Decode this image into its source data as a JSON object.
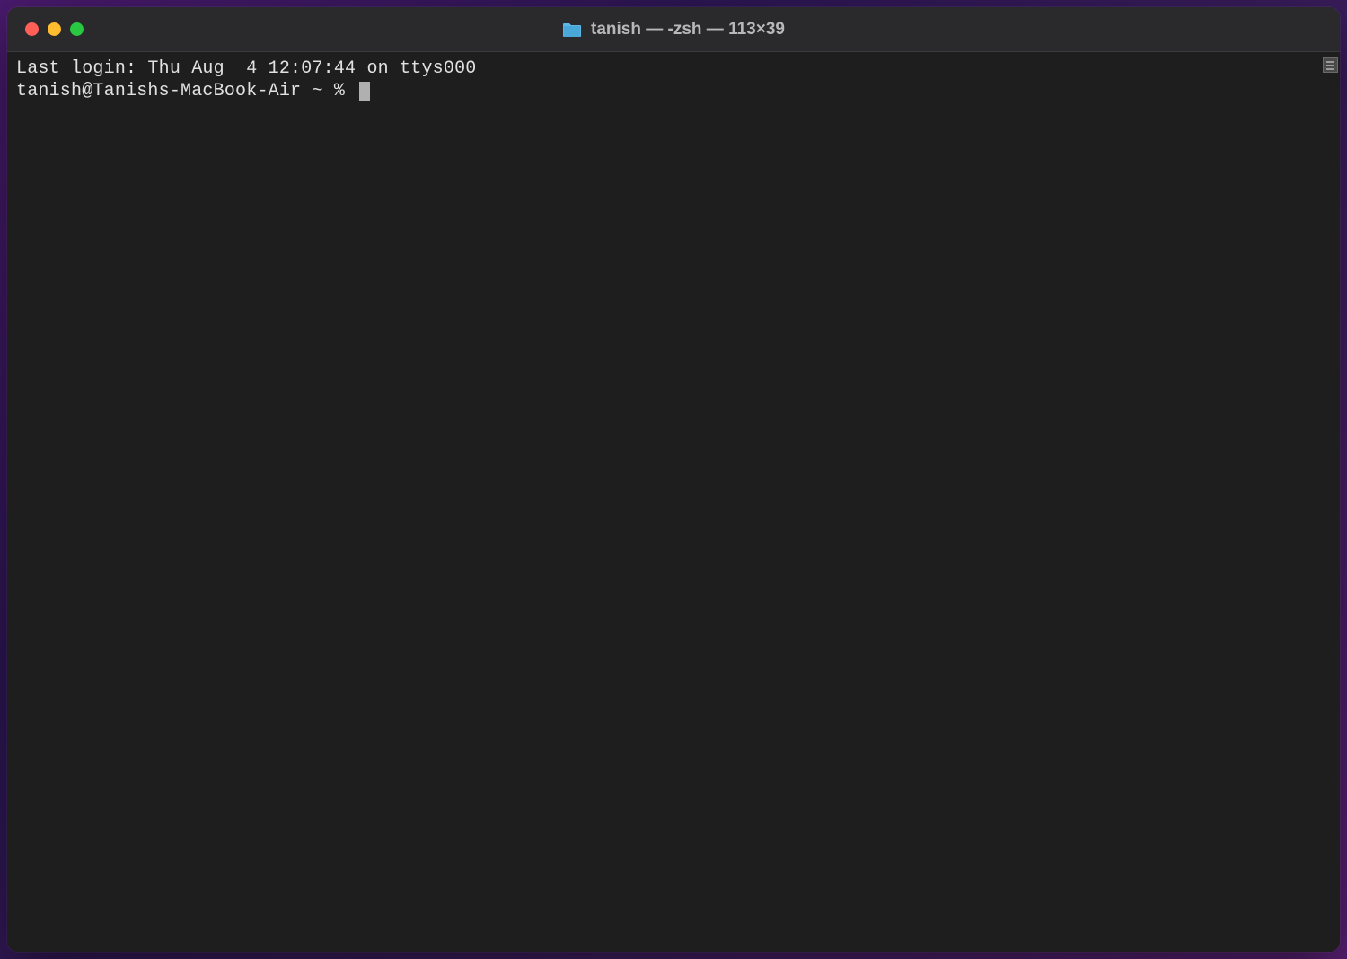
{
  "window": {
    "title": "tanish — -zsh — 113×39",
    "colors": {
      "close": "#ff5f57",
      "minimize": "#febc2e",
      "zoom": "#28c840"
    }
  },
  "terminal": {
    "last_login": "Last login: Thu Aug  4 12:07:44 on ttys000",
    "prompt": "tanish@Tanishs-MacBook-Air ~ % "
  }
}
